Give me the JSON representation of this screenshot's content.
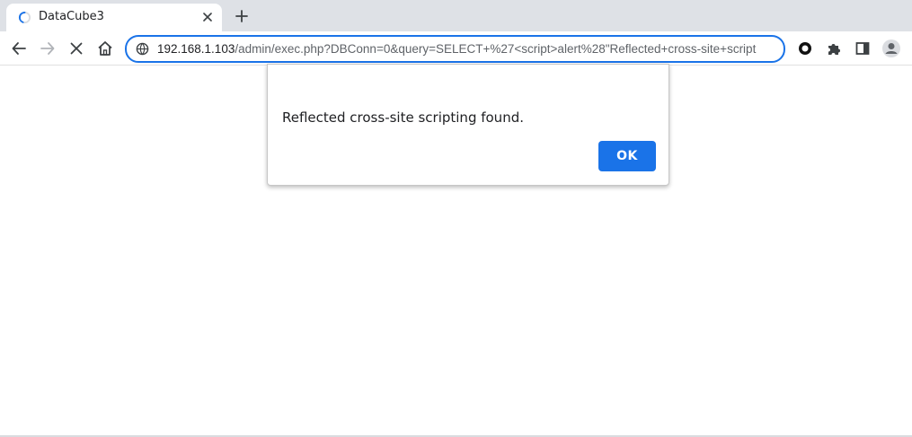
{
  "browser": {
    "tab": {
      "title": "DataCube3",
      "loading_icon": "spinner-icon",
      "close_icon": "close-icon"
    },
    "new_tab_icon": "plus-icon",
    "toolbar": {
      "back_icon": "back-arrow-icon",
      "forward_icon": "forward-arrow-icon",
      "stop_icon": "stop-icon",
      "home_icon": "home-icon",
      "address_icon": "site-info-icon",
      "address_host": "192.168.1.103",
      "address_rest": "/admin/exec.php?DBConn=0&query=SELECT+%27<script>alert%28\"Reflected+cross-site+script",
      "extension_icons": [
        "record-icon",
        "puzzle-extensions-icon",
        "side-panel-icon",
        "profile-icon"
      ]
    }
  },
  "dialog": {
    "message": "Reflected cross-site scripting found.",
    "ok_label": "OK"
  },
  "colors": {
    "accent": "#1a73e8",
    "tabstrip": "#dee1e6"
  }
}
